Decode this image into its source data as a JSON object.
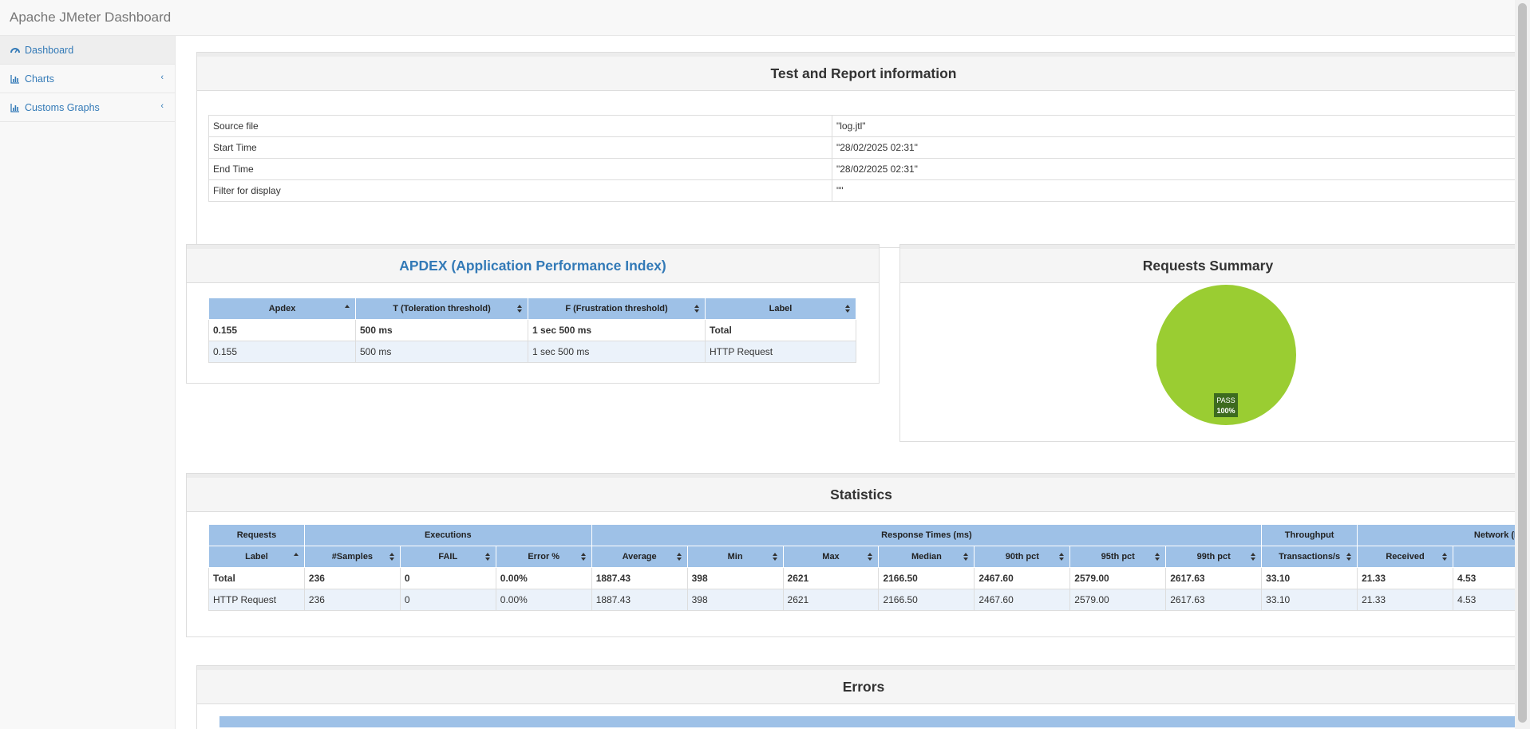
{
  "app": {
    "title": "Apache JMeter Dashboard"
  },
  "sidebar": {
    "items": [
      {
        "label": "Dashboard",
        "icon": "dashboard-icon"
      },
      {
        "label": "Charts",
        "icon": "bar-chart-icon"
      },
      {
        "label": "Customs Graphs",
        "icon": "bar-chart-icon"
      }
    ]
  },
  "test_info": {
    "title": "Test and Report information",
    "rows": [
      {
        "key": "Source file",
        "value": "\"log.jtl\""
      },
      {
        "key": "Start Time",
        "value": "\"28/02/2025 02:31\""
      },
      {
        "key": "End Time",
        "value": "\"28/02/2025 02:31\""
      },
      {
        "key": "Filter for display",
        "value": "\"\""
      }
    ]
  },
  "apdex": {
    "title": "APDEX (Application Performance Index)",
    "headers": [
      "Apdex",
      "T (Toleration threshold)",
      "F (Frustration threshold)",
      "Label"
    ],
    "rows": [
      [
        "0.155",
        "500 ms",
        "1 sec 500 ms",
        "Total"
      ],
      [
        "0.155",
        "500 ms",
        "1 sec 500 ms",
        "HTTP Request"
      ]
    ]
  },
  "summary": {
    "title": "Requests Summary",
    "slices": [
      {
        "label": "PASS",
        "percent": "100%",
        "value": 100,
        "color": "#9acd32"
      }
    ]
  },
  "statistics": {
    "title": "Statistics",
    "groups": [
      "Requests",
      "Executions",
      "Response Times (ms)",
      "Throughput",
      "Network (KB/sec)"
    ],
    "headers": [
      "Label",
      "#Samples",
      "FAIL",
      "Error %",
      "Average",
      "Min",
      "Max",
      "Median",
      "90th pct",
      "95th pct",
      "99th pct",
      "Transactions/s",
      "Received",
      ""
    ],
    "rows": [
      [
        "Total",
        "236",
        "0",
        "0.00%",
        "1887.43",
        "398",
        "2621",
        "2166.50",
        "2467.60",
        "2579.00",
        "2617.63",
        "33.10",
        "21.33",
        "4.53"
      ],
      [
        "HTTP Request",
        "236",
        "0",
        "0.00%",
        "1887.43",
        "398",
        "2621",
        "2166.50",
        "2467.60",
        "2579.00",
        "2617.63",
        "33.10",
        "21.33",
        "4.53"
      ]
    ]
  },
  "errors": {
    "title": "Errors"
  },
  "colors": {
    "header_blue": "#9ec1e7",
    "link": "#337ab7",
    "pass": "#9acd32"
  }
}
